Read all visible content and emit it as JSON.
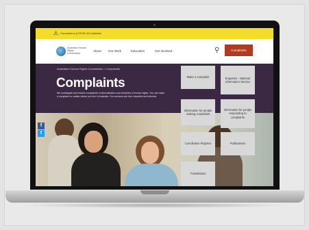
{
  "alert": {
    "icon": "warning-icon",
    "text": "Coronavirus (COVID-19) Updates"
  },
  "header": {
    "logo_text": "Australian Human Rights Commission",
    "nav": [
      "About",
      "Our Work",
      "Education",
      "Get Involved"
    ],
    "search_icon": "search-icon",
    "complaints_button": "Complaints",
    "accent": "#b43a1f"
  },
  "hero": {
    "breadcrumb": "Australian Human Rights Commission  >  Complaints",
    "title": "Complaints",
    "description": "We investigate and resolve complaints of discrimination and breaches of human rights. You can make a complaint no matter where you live in Australia. Our services are free, impartial and informal.",
    "background": "#3b2842"
  },
  "share": [
    {
      "icon": "facebook-icon",
      "glyph": "f",
      "color": "#3b5998"
    },
    {
      "icon": "twitter-icon",
      "glyph": "t",
      "color": "#1da1f2"
    }
  ],
  "tiles": [
    "Make a complaint",
    "Enquiries - National Information Service",
    "Information for people making complaints",
    "Information for people responding to complaints",
    "Conciliation Register",
    "Publications",
    "Translations"
  ]
}
